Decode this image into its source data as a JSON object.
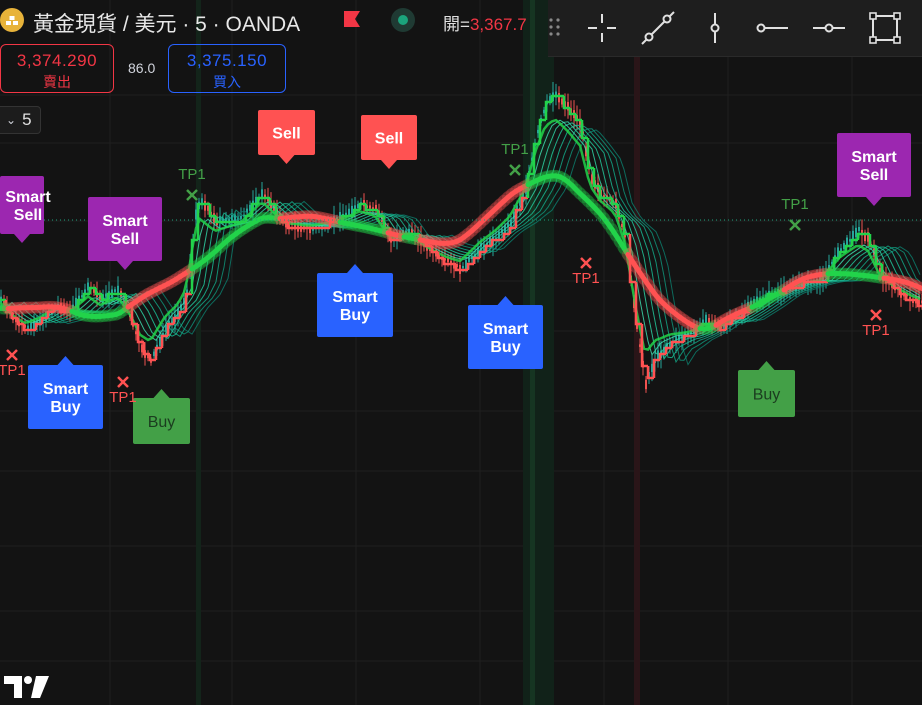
{
  "header": {
    "symbol_title": "黃金現貨 / 美元 · 5 · OANDA",
    "open_label": "開=",
    "open_value": "3,367.7"
  },
  "quote": {
    "sell_price": "3,374.290",
    "sell_label": "賣出",
    "spread": "86.0",
    "buy_price": "3,375.150",
    "buy_label": "買入"
  },
  "interval": {
    "value": "5"
  },
  "toolbar": {
    "tools": [
      "crosshair-icon",
      "trend-line-icon",
      "vertical-line-icon",
      "horizontal-ray-icon",
      "horizontal-line-icon",
      "rectangle-icon"
    ]
  },
  "colors": {
    "background": "#131313",
    "bull": "#22d34a",
    "bear": "#ff5252",
    "smart_sell": "#9c27b0",
    "smart_buy": "#2962ff",
    "buy": "#43a047",
    "sell": "#ff5252",
    "tp_green": "#43a047",
    "tp_red": "#ff5252"
  },
  "chart_data": {
    "type": "line",
    "title": "",
    "series": [],
    "annotations": [
      {
        "label": "Smart Sell",
        "kind": "smart_sell"
      },
      {
        "label": "Smart Sell",
        "kind": "smart_sell"
      },
      {
        "label": "Sell",
        "kind": "sell"
      },
      {
        "label": "Sell",
        "kind": "sell"
      },
      {
        "label": "Smart Sell",
        "kind": "smart_sell"
      },
      {
        "label": "Smart Buy",
        "kind": "smart_buy"
      },
      {
        "label": "Smart Buy",
        "kind": "smart_buy"
      },
      {
        "label": "Smart Buy",
        "kind": "smart_buy"
      },
      {
        "label": "Buy",
        "kind": "buy"
      },
      {
        "label": "Buy",
        "kind": "buy"
      },
      {
        "label": "TP1",
        "kind": "tp_red"
      },
      {
        "label": "TP1",
        "kind": "tp_red"
      },
      {
        "label": "TP1",
        "kind": "tp_green"
      },
      {
        "label": "TP1",
        "kind": "tp_green"
      },
      {
        "label": "TP1",
        "kind": "tp_red"
      },
      {
        "label": "TP1",
        "kind": "tp_green"
      },
      {
        "label": "TP1",
        "kind": "tp_red"
      }
    ]
  }
}
